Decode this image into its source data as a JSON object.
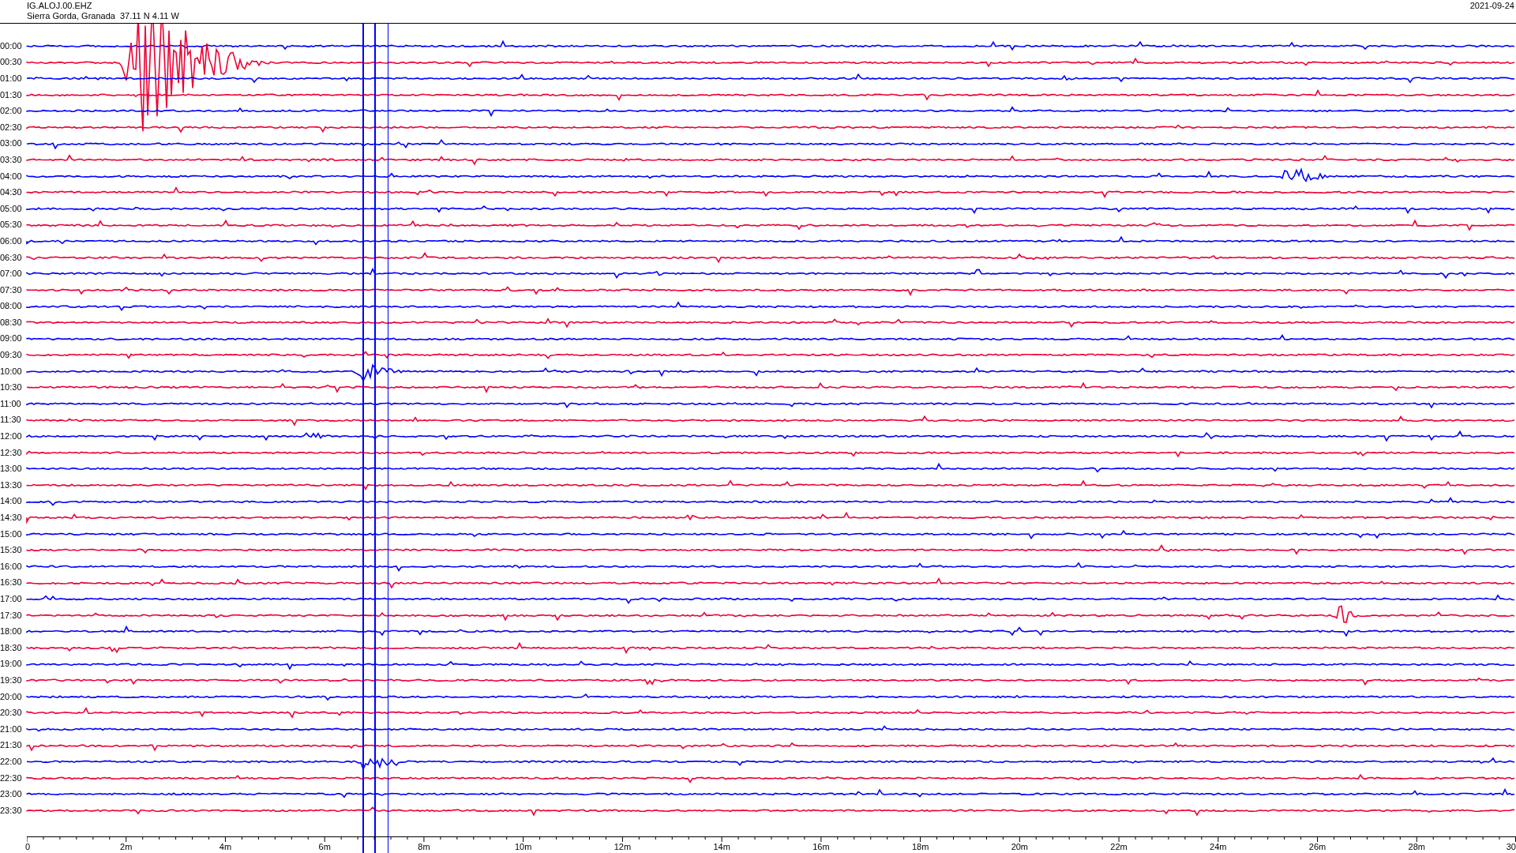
{
  "header": {
    "station": "IG.ALOJ.00.EHZ",
    "location": "Sierra Gorda, Granada  37.11 N 4.11 W",
    "date": "2021-09-24"
  },
  "rows": [
    {
      "label": "00:00",
      "color": "#0000ff"
    },
    {
      "label": "00:30",
      "color": "#ee0033"
    },
    {
      "label": "01:00",
      "color": "#0000ff"
    },
    {
      "label": "01:30",
      "color": "#ee0033"
    },
    {
      "label": "02:00",
      "color": "#0000ff"
    },
    {
      "label": "02:30",
      "color": "#ee0033"
    },
    {
      "label": "03:00",
      "color": "#0000ff"
    },
    {
      "label": "03:30",
      "color": "#ee0033"
    },
    {
      "label": "04:00",
      "color": "#0000ff"
    },
    {
      "label": "04:30",
      "color": "#ee0033"
    },
    {
      "label": "05:00",
      "color": "#0000ff"
    },
    {
      "label": "05:30",
      "color": "#ee0033"
    },
    {
      "label": "06:00",
      "color": "#0000ff"
    },
    {
      "label": "06:30",
      "color": "#ee0033"
    },
    {
      "label": "07:00",
      "color": "#0000ff"
    },
    {
      "label": "07:30",
      "color": "#ee0033"
    },
    {
      "label": "08:00",
      "color": "#0000ff"
    },
    {
      "label": "08:30",
      "color": "#ee0033"
    },
    {
      "label": "09:00",
      "color": "#0000ff"
    },
    {
      "label": "09:30",
      "color": "#ee0033"
    },
    {
      "label": "10:00",
      "color": "#0000ff"
    },
    {
      "label": "10:30",
      "color": "#ee0033"
    },
    {
      "label": "11:00",
      "color": "#0000ff"
    },
    {
      "label": "11:30",
      "color": "#ee0033"
    },
    {
      "label": "12:00",
      "color": "#0000ff"
    },
    {
      "label": "12:30",
      "color": "#ee0033"
    },
    {
      "label": "13:00",
      "color": "#0000ff"
    },
    {
      "label": "13:30",
      "color": "#ee0033"
    },
    {
      "label": "14:00",
      "color": "#0000ff"
    },
    {
      "label": "14:30",
      "color": "#ee0033"
    },
    {
      "label": "15:00",
      "color": "#0000ff"
    },
    {
      "label": "15:30",
      "color": "#ee0033"
    },
    {
      "label": "16:00",
      "color": "#0000ff"
    },
    {
      "label": "16:30",
      "color": "#ee0033"
    },
    {
      "label": "17:00",
      "color": "#0000ff"
    },
    {
      "label": "17:30",
      "color": "#ee0033"
    },
    {
      "label": "18:00",
      "color": "#0000ff"
    },
    {
      "label": "18:30",
      "color": "#ee0033"
    },
    {
      "label": "19:00",
      "color": "#0000ff"
    },
    {
      "label": "19:30",
      "color": "#ee0033"
    },
    {
      "label": "20:00",
      "color": "#0000ff"
    },
    {
      "label": "20:30",
      "color": "#ee0033"
    },
    {
      "label": "21:00",
      "color": "#0000ff"
    },
    {
      "label": "21:30",
      "color": "#ee0033"
    },
    {
      "label": "22:00",
      "color": "#0000ff"
    },
    {
      "label": "22:30",
      "color": "#ee0033"
    },
    {
      "label": "23:00",
      "color": "#0000ff"
    },
    {
      "label": "23:30",
      "color": "#ee0033"
    }
  ],
  "axis": {
    "ticks": [
      "0",
      "2m",
      "4m",
      "6m",
      "8m",
      "10m",
      "12m",
      "14m",
      "16m",
      "18m",
      "20m",
      "22m",
      "24m",
      "26m",
      "28m",
      "30"
    ]
  }
}
